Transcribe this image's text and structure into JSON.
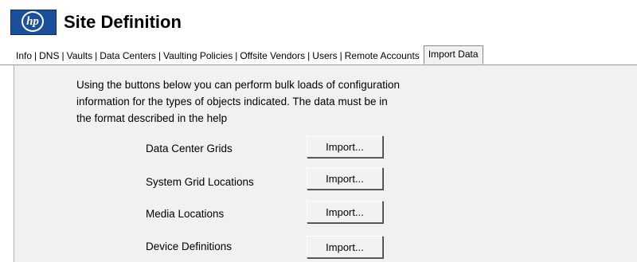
{
  "header": {
    "logo_text": "hp",
    "title": "Site Definition"
  },
  "tabs": [
    {
      "label": "Info"
    },
    {
      "label": "DNS"
    },
    {
      "label": "Vaults"
    },
    {
      "label": "Data Centers"
    },
    {
      "label": "Vaulting Policies"
    },
    {
      "label": "Offsite Vendors"
    },
    {
      "label": "Users"
    },
    {
      "label": "Remote Accounts"
    },
    {
      "label": "Import Data",
      "active": true
    }
  ],
  "panel": {
    "description_lines": [
      "Using the buttons below you can perform bulk loads of configuration",
      "information for the types of objects indicated.  The data must be in",
      "the format described in the help"
    ],
    "rows": [
      {
        "label": "Data Center Grids",
        "button": "Import..."
      },
      {
        "label": "System Grid Locations",
        "button": "Import..."
      },
      {
        "label": "Media Locations",
        "button": "Import..."
      },
      {
        "label": "Device Definitions",
        "button": "Import..."
      }
    ]
  },
  "colors": {
    "panel_bg": "#f1f1f1",
    "logo_bg": "#1a4f9c"
  },
  "icons": {
    "logo": "hp-logo-icon"
  }
}
